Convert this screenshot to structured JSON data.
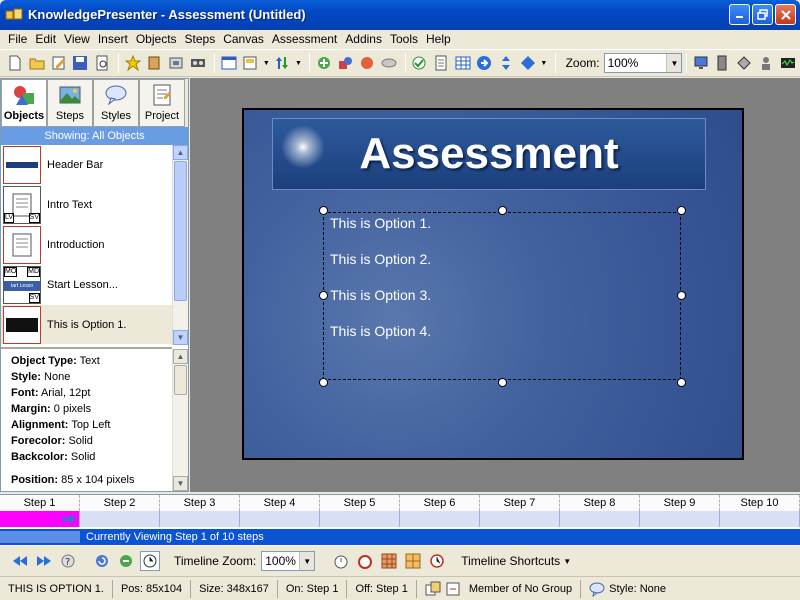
{
  "window": {
    "title": "KnowledgePresenter - Assessment (Untitled)"
  },
  "menu": [
    "File",
    "Edit",
    "View",
    "Insert",
    "Objects",
    "Steps",
    "Canvas",
    "Assessment",
    "Addins",
    "Tools",
    "Help"
  ],
  "toolbar": {
    "zoom_label": "Zoom:",
    "zoom_value": "100%"
  },
  "left_panel": {
    "tabs": [
      "Objects",
      "Steps",
      "Styles",
      "Project"
    ],
    "showing": "Showing: All Objects",
    "objects": [
      "Header Bar",
      "Intro Text",
      "Introduction",
      "Start Lesson...",
      "This is Option 1."
    ],
    "thumb_badges": {
      "lv": "LV",
      "sv": "SV",
      "mo": "MO",
      "md": "MD",
      "start": "tart Lesso"
    },
    "properties": [
      {
        "k": "Object Type:",
        "v": "Text"
      },
      {
        "k": "Style:",
        "v": "None"
      },
      {
        "k": "Font:",
        "v": "Arial, 12pt"
      },
      {
        "k": "Margin:",
        "v": "0 pixels"
      },
      {
        "k": "Alignment:",
        "v": "Top Left"
      },
      {
        "k": "Forecolor:",
        "v": "Solid"
      },
      {
        "k": "Backcolor:",
        "v": "Solid"
      }
    ],
    "position": {
      "k": "Position:",
      "v": "85 x 104 pixels"
    }
  },
  "slide": {
    "title": "Assessment",
    "options": [
      "This is Option 1.",
      "This is Option 2.",
      "This is Option 3.",
      "This is Option 4."
    ]
  },
  "timeline": {
    "steps": [
      "Step 1",
      "Step 2",
      "Step 3",
      "Step 4",
      "Step 5",
      "Step 6",
      "Step 7",
      "Step 8",
      "Step 9",
      "Step 10"
    ],
    "status": "Currently Viewing Step 1 of 10 steps"
  },
  "bottom_toolbar": {
    "timeline_zoom_label": "Timeline Zoom:",
    "timeline_zoom_value": "100%",
    "shortcuts": "Timeline Shortcuts"
  },
  "statusbar": {
    "object": "THIS IS OPTION 1.",
    "pos": "Pos: 85x104",
    "size": "Size: 348x167",
    "on": "On: Step 1",
    "off": "Off: Step 1",
    "group": "Member of No Group",
    "style": "Style: None"
  },
  "colors": {
    "accent": "#0a54d4",
    "highlight": "#ff00ff",
    "canvas_bg": "#808080"
  }
}
